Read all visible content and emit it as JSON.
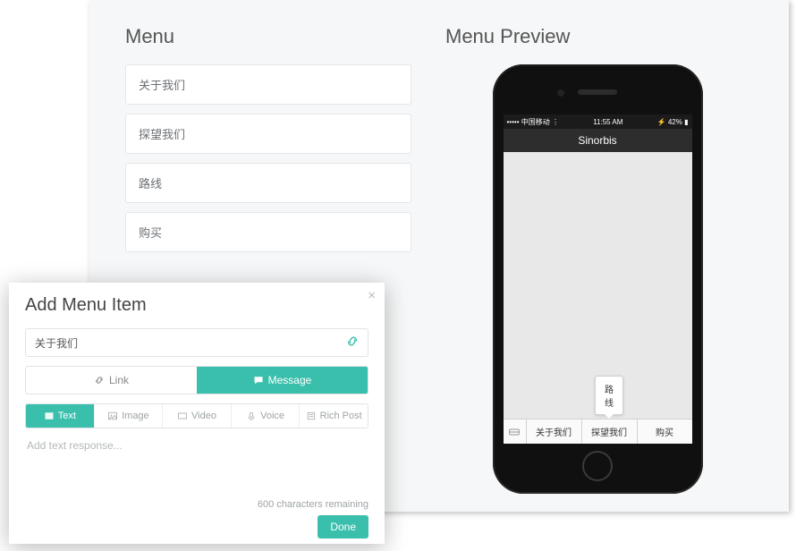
{
  "menu": {
    "title": "Menu",
    "items": [
      "关于我们",
      "探望我们",
      "路线",
      "购买"
    ]
  },
  "preview": {
    "title": "Menu Preview",
    "status": {
      "carrier": "中国移动",
      "time": "11:55 AM",
      "battery": "42%"
    },
    "app_title": "Sinorbis",
    "popup": "路线",
    "buttons": [
      "关于我们",
      "探望我们",
      "购买"
    ]
  },
  "modal": {
    "title": "Add Menu Item",
    "name_value": "关于我们",
    "link_tab": "Link",
    "message_tab": "Message",
    "resp_tabs": {
      "text": "Text",
      "image": "Image",
      "video": "Video",
      "voice": "Voice",
      "rich": "Rich Post"
    },
    "placeholder": "Add text response...",
    "counter": "600 characters remaining",
    "done": "Done"
  },
  "colors": {
    "accent": "#3bbfad"
  }
}
